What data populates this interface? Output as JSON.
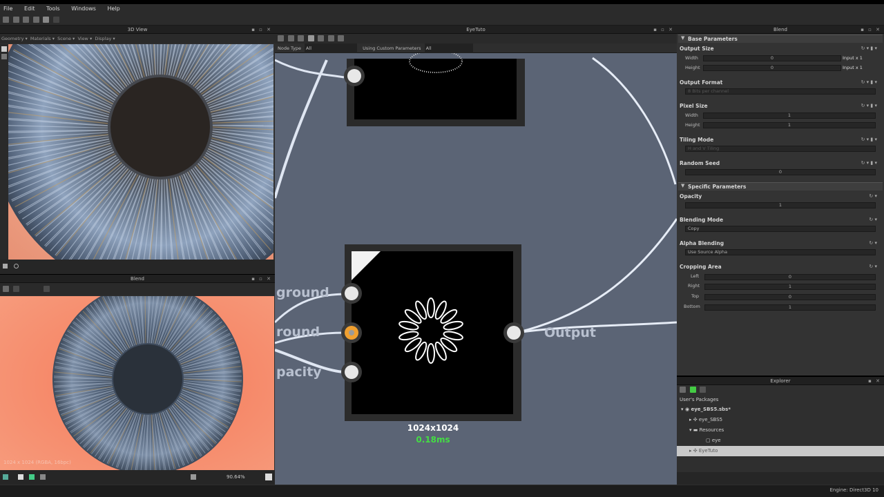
{
  "menu": [
    "File",
    "Edit",
    "Tools",
    "Windows",
    "Help"
  ],
  "view3d": {
    "title": "3D View",
    "toolbar": [
      "Geometry",
      "Materials",
      "Scene",
      "View",
      "Display"
    ]
  },
  "view2d": {
    "title": "Blend",
    "info": "1024 x 1024 (RGBA, 16bpc)",
    "zoom": "90.64%"
  },
  "graph": {
    "title": "EyeTuto",
    "filter_label": "Node Type",
    "filter_value": "All",
    "custom_label": "Using Custom Parameters",
    "custom_value": "All",
    "node": {
      "resolution": "1024x1024",
      "time": "0.18ms",
      "inputs": [
        "ground",
        "round",
        "pacity"
      ],
      "output": "Output"
    }
  },
  "properties": {
    "title": "Blend",
    "base_section": "Base Parameters",
    "output_size": {
      "label": "Output Size",
      "width_label": "Width",
      "height_label": "Height",
      "width_value": "0",
      "height_value": "0",
      "width_mode": "Input x 1",
      "height_mode": "Input x 1"
    },
    "output_format": {
      "label": "Output Format",
      "value": "8 Bits per channel"
    },
    "pixel_size": {
      "label": "Pixel Size",
      "width_label": "Width",
      "height_label": "Height",
      "width_value": "1",
      "height_value": "1"
    },
    "tiling_mode": {
      "label": "Tiling Mode",
      "value": "H and V Tiling"
    },
    "random_seed": {
      "label": "Random Seed",
      "value": "0"
    },
    "specific_section": "Specific Parameters",
    "opacity": {
      "label": "Opacity",
      "value": "1"
    },
    "blending_mode": {
      "label": "Blending Mode",
      "value": "Copy"
    },
    "alpha_blending": {
      "label": "Alpha Blending",
      "value": "Use Source Alpha"
    },
    "cropping": {
      "label": "Cropping Area",
      "left_label": "Left",
      "left_value": "0",
      "right_label": "Right",
      "right_value": "1",
      "top_label": "Top",
      "top_value": "0",
      "bottom_label": "Bottom",
      "bottom_value": "1"
    }
  },
  "explorer": {
    "title": "Explorer",
    "root": "User's Packages",
    "items": [
      "eye_SBS5.sbs*",
      "eye_SBS5",
      "Resources",
      "eye",
      "EyeTuto"
    ]
  },
  "status": {
    "engine": "Engine: Direct3D 10"
  },
  "colors": {
    "graph_bg": "#5b6475",
    "panel_bg": "#333333",
    "accent_orange": "#f0a030",
    "time_green": "#44dd44"
  }
}
